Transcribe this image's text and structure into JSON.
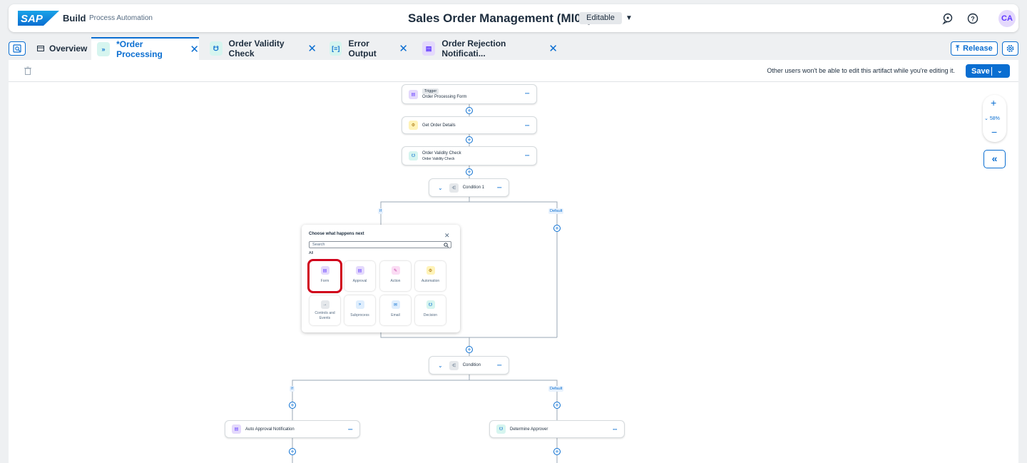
{
  "shell": {
    "logo": "SAP",
    "product": "Build",
    "subproduct": "Process Automation",
    "title": "Sales Order Management (MI03)",
    "status": "Editable",
    "avatar": "CA"
  },
  "tabs": [
    {
      "label": "Overview",
      "active": false
    },
    {
      "label": "*Order Processing",
      "active": true,
      "close": "✕"
    },
    {
      "label": "Order Validity Check",
      "active": false,
      "close": "✕"
    },
    {
      "label": "Error Output",
      "active": false,
      "close": "✕"
    },
    {
      "label": "Order Rejection Notificati...",
      "active": false,
      "close": "✕"
    }
  ],
  "tabbar": {
    "release_label": "Release"
  },
  "toolbar": {
    "notice": "Other users won't be able to edit this artifact while you're editing it.",
    "save_label": "Save"
  },
  "canvas": {
    "zoom": "58%",
    "trigger": {
      "badge": "Trigger",
      "label": "Order Processing Form"
    },
    "get_order": "Get Order Details",
    "validity": {
      "label": "Order Validity Check",
      "sublabel": "Order Validity Check"
    },
    "condition1": "Condition 1",
    "condition2": "Condition",
    "if_label": "If",
    "default_label": "Default",
    "auto_approval": "Auto Approval Notification",
    "determine_approver": "Determine Approver"
  },
  "popover": {
    "title": "Choose what happens next",
    "search_placeholder": "Search",
    "section": "All",
    "options": [
      {
        "label": "Form",
        "selected": true
      },
      {
        "label": "Approval"
      },
      {
        "label": "Action"
      },
      {
        "label": "Automation"
      },
      {
        "label": "Controls and Events"
      },
      {
        "label": "Subprocess"
      },
      {
        "label": "Email"
      },
      {
        "label": "Decision"
      }
    ]
  },
  "colors": {
    "accent": "#0a6ed1",
    "highlight": "#d0021b"
  }
}
